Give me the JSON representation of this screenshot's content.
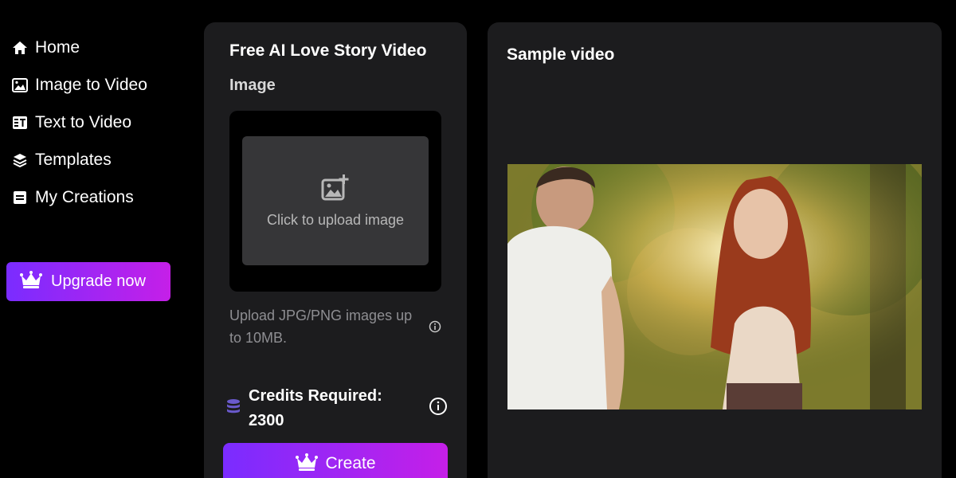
{
  "sidebar": {
    "items": [
      {
        "label": "Home",
        "icon": "home-icon"
      },
      {
        "label": "Image to Video",
        "icon": "image-icon"
      },
      {
        "label": "Text to Video",
        "icon": "text-video-icon"
      },
      {
        "label": "Templates",
        "icon": "layers-icon"
      },
      {
        "label": "My Creations",
        "icon": "creations-icon"
      }
    ],
    "upgrade_label": "Upgrade now"
  },
  "form": {
    "title": "Free AI Love Story Video",
    "image_label": "Image",
    "upload_text": "Click to upload image",
    "hint": "Upload JPG/PNG images up to 10MB.",
    "credits_label": "Credits Required: 2300",
    "create_label": "Create"
  },
  "sample": {
    "title": "Sample video"
  },
  "colors": {
    "accent_start": "#7a2cff",
    "accent_end": "#c51fe8",
    "panel_bg": "#1c1c1e",
    "coin": "#6a5acd"
  }
}
